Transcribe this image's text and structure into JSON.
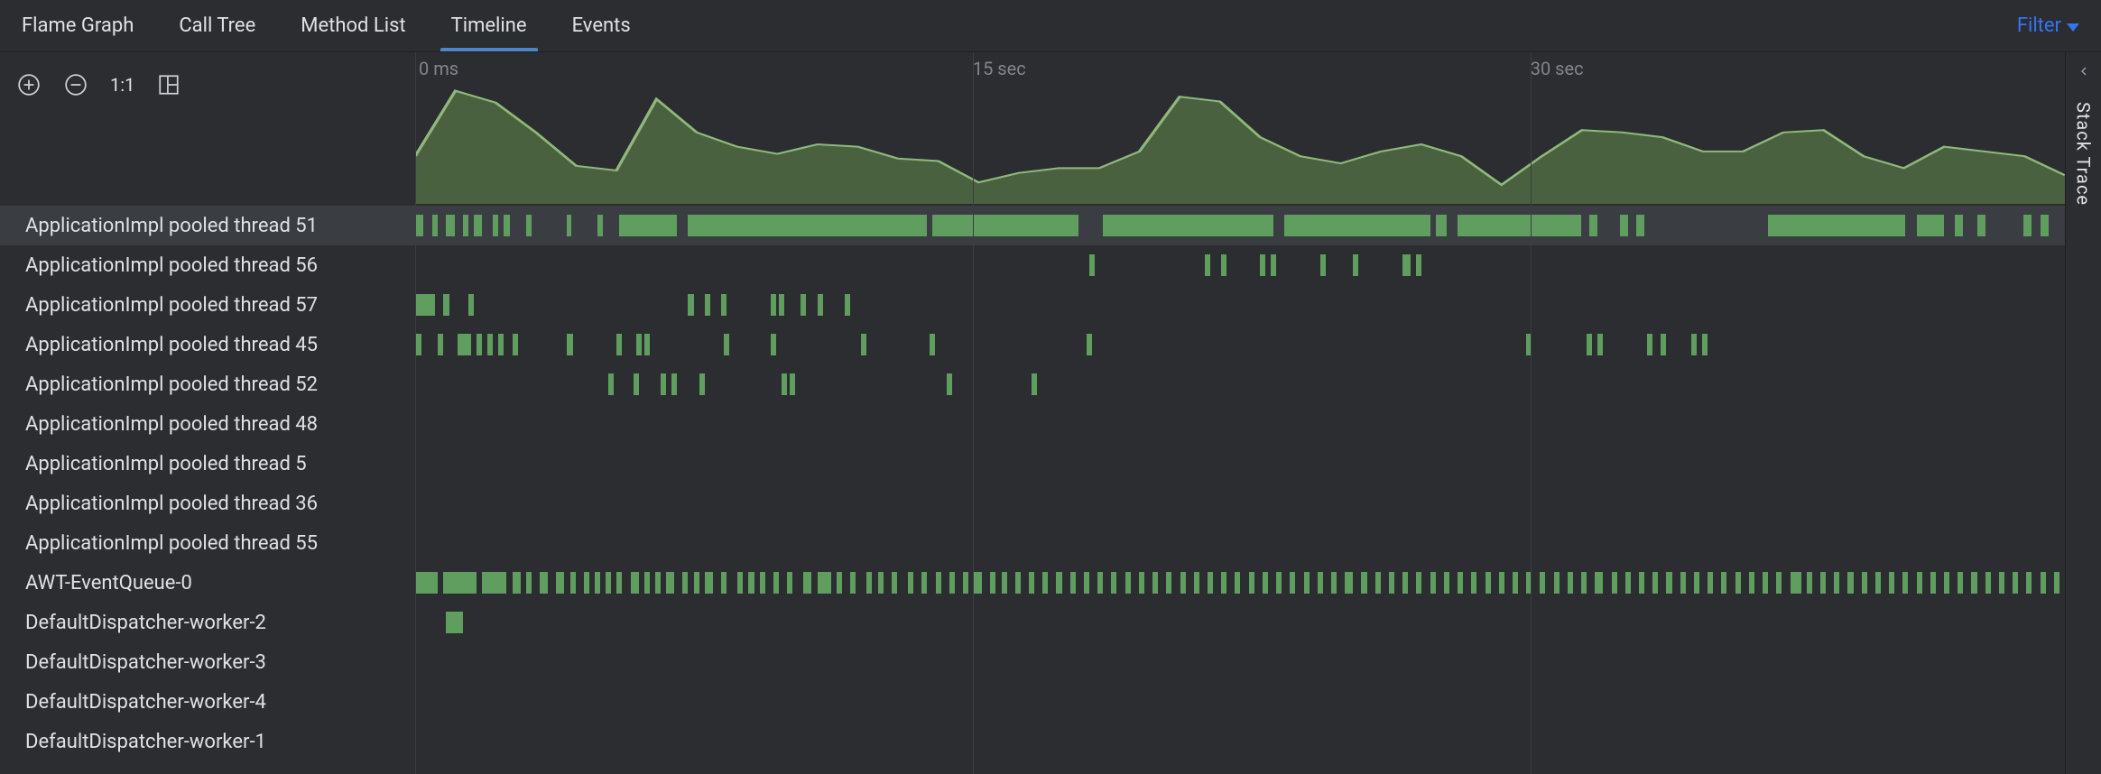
{
  "tabs": {
    "flame": "Flame Graph",
    "calltree": "Call Tree",
    "methodlist": "Method List",
    "timeline": "Timeline",
    "events": "Events"
  },
  "selected_tab": "timeline",
  "filter_label": "Filter",
  "toolbox": {
    "oneone": "1:1"
  },
  "ruler": {
    "t0": "0 ms",
    "t1": "15 sec",
    "t2": "30 sec"
  },
  "colors": {
    "area_fill": "#4f6b42",
    "area_stroke": "#8fb87a",
    "seg": "#5f9e5f",
    "accent": "#3574f0"
  },
  "side_panel_label": "Stack Trace",
  "chart_data": {
    "type": "area",
    "title": "",
    "xlabel": "time",
    "ylabel": "",
    "ylim": [
      0,
      100
    ],
    "x_range": [
      0,
      45
    ],
    "values": [
      40,
      95,
      85,
      60,
      32,
      28,
      88,
      60,
      48,
      42,
      50,
      48,
      38,
      36,
      18,
      26,
      30,
      30,
      44,
      90,
      86,
      56,
      40,
      34,
      44,
      50,
      40,
      16,
      40,
      62,
      60,
      56,
      44,
      44,
      60,
      62,
      40,
      30,
      48,
      44,
      40,
      24
    ]
  },
  "threads": [
    {
      "name": "ApplicationImpl pooled thread 51",
      "selected": true,
      "segs": [
        [
          0,
          0.5
        ],
        [
          1.2,
          0.4
        ],
        [
          2.2,
          0.6
        ],
        [
          3.4,
          0.4
        ],
        [
          4.2,
          0.6
        ],
        [
          5.6,
          0.4
        ],
        [
          6.4,
          0.4
        ],
        [
          8.0,
          0.4
        ],
        [
          11.0,
          0.3
        ],
        [
          13.2,
          0.4
        ],
        [
          14.8,
          4.2
        ],
        [
          19.8,
          17.4
        ],
        [
          37.6,
          10.6
        ],
        [
          50.0,
          12.4
        ],
        [
          63.2,
          10.6
        ],
        [
          74.2,
          0.8
        ],
        [
          75.8,
          9.0
        ],
        [
          85.4,
          0.6
        ],
        [
          87.6,
          0.6
        ],
        [
          88.8,
          0.6
        ],
        [
          98.4,
          10.0
        ],
        [
          109.2,
          2.0
        ],
        [
          112.0,
          0.6
        ],
        [
          113.6,
          0.6
        ],
        [
          117.0,
          0.6
        ],
        [
          118.2,
          0.6
        ]
      ]
    },
    {
      "name": "ApplicationImpl pooled thread 56",
      "selected": false,
      "segs": [
        [
          49.0,
          0.4
        ],
        [
          57.4,
          0.4
        ],
        [
          58.6,
          0.4
        ],
        [
          61.4,
          0.4
        ],
        [
          62.2,
          0.4
        ],
        [
          65.8,
          0.4
        ],
        [
          68.2,
          0.4
        ],
        [
          71.8,
          0.6
        ],
        [
          72.8,
          0.4
        ]
      ]
    },
    {
      "name": "ApplicationImpl pooled thread 57",
      "selected": false,
      "segs": [
        [
          0,
          1.4
        ],
        [
          2.0,
          0.4
        ],
        [
          3.8,
          0.4
        ],
        [
          19.8,
          0.4
        ],
        [
          21.0,
          0.4
        ],
        [
          22.2,
          0.4
        ],
        [
          25.8,
          0.4
        ],
        [
          26.4,
          0.4
        ],
        [
          28.0,
          0.4
        ],
        [
          29.2,
          0.4
        ],
        [
          31.2,
          0.4
        ]
      ]
    },
    {
      "name": "ApplicationImpl pooled thread 45",
      "selected": false,
      "segs": [
        [
          0,
          0.4
        ],
        [
          1.6,
          0.4
        ],
        [
          3.0,
          1.0
        ],
        [
          4.4,
          0.4
        ],
        [
          5.2,
          0.4
        ],
        [
          6.0,
          0.4
        ],
        [
          7.0,
          0.4
        ],
        [
          11.0,
          0.4
        ],
        [
          14.6,
          0.4
        ],
        [
          16.0,
          0.4
        ],
        [
          16.6,
          0.4
        ],
        [
          22.4,
          0.4
        ],
        [
          25.8,
          0.4
        ],
        [
          32.4,
          0.4
        ],
        [
          37.4,
          0.4
        ],
        [
          48.8,
          0.4
        ],
        [
          80.8,
          0.4
        ],
        [
          85.2,
          0.4
        ],
        [
          86.0,
          0.4
        ],
        [
          89.6,
          0.4
        ],
        [
          90.6,
          0.4
        ],
        [
          92.8,
          0.4
        ],
        [
          93.6,
          0.4
        ]
      ]
    },
    {
      "name": "ApplicationImpl pooled thread 52",
      "selected": false,
      "segs": [
        [
          14.0,
          0.4
        ],
        [
          15.8,
          0.4
        ],
        [
          17.8,
          0.4
        ],
        [
          18.6,
          0.4
        ],
        [
          20.6,
          0.4
        ],
        [
          26.6,
          0.4
        ],
        [
          27.2,
          0.4
        ],
        [
          38.6,
          0.4
        ],
        [
          44.8,
          0.4
        ]
      ]
    },
    {
      "name": "ApplicationImpl pooled thread 48",
      "selected": false,
      "segs": []
    },
    {
      "name": "ApplicationImpl pooled thread 5",
      "selected": false,
      "segs": []
    },
    {
      "name": "ApplicationImpl pooled thread 36",
      "selected": false,
      "segs": []
    },
    {
      "name": "ApplicationImpl pooled thread 55",
      "selected": false,
      "segs": []
    },
    {
      "name": "AWT-EventQueue-0",
      "selected": false,
      "segs": [
        [
          0,
          1.6
        ],
        [
          2.0,
          2.4
        ],
        [
          4.8,
          1.8
        ],
        [
          7.0,
          0.6
        ],
        [
          8.0,
          0.4
        ],
        [
          9.0,
          0.6
        ],
        [
          10.2,
          0.6
        ],
        [
          11.2,
          0.4
        ],
        [
          12.2,
          0.4
        ],
        [
          13.0,
          0.4
        ],
        [
          13.8,
          0.4
        ],
        [
          14.6,
          0.4
        ],
        [
          15.6,
          0.6
        ],
        [
          16.6,
          0.4
        ],
        [
          17.4,
          0.4
        ],
        [
          18.2,
          0.6
        ],
        [
          19.4,
          0.4
        ],
        [
          20.2,
          0.4
        ],
        [
          21.0,
          0.6
        ],
        [
          22.2,
          0.4
        ],
        [
          23.4,
          0.4
        ],
        [
          24.2,
          0.4
        ],
        [
          25.0,
          0.4
        ],
        [
          26.0,
          0.4
        ],
        [
          27.0,
          0.4
        ],
        [
          28.2,
          0.6
        ],
        [
          29.2,
          1.0
        ],
        [
          30.6,
          0.4
        ],
        [
          31.6,
          0.4
        ],
        [
          32.8,
          0.4
        ],
        [
          33.6,
          0.4
        ],
        [
          34.6,
          0.4
        ],
        [
          35.8,
          0.4
        ],
        [
          36.8,
          0.4
        ],
        [
          37.8,
          0.4
        ],
        [
          38.8,
          0.4
        ],
        [
          39.8,
          0.4
        ],
        [
          40.6,
          0.6
        ],
        [
          41.8,
          0.4
        ],
        [
          42.6,
          0.4
        ],
        [
          43.6,
          0.4
        ],
        [
          44.6,
          0.4
        ],
        [
          45.6,
          0.4
        ],
        [
          46.6,
          0.4
        ],
        [
          47.6,
          0.4
        ],
        [
          48.6,
          0.4
        ],
        [
          49.6,
          0.4
        ],
        [
          50.6,
          0.4
        ],
        [
          51.6,
          0.4
        ],
        [
          52.6,
          0.4
        ],
        [
          53.6,
          0.4
        ],
        [
          54.6,
          0.4
        ],
        [
          55.6,
          0.4
        ],
        [
          56.6,
          0.4
        ],
        [
          57.6,
          0.4
        ],
        [
          58.6,
          0.4
        ],
        [
          59.6,
          0.4
        ],
        [
          60.6,
          0.4
        ],
        [
          61.6,
          0.4
        ],
        [
          62.6,
          0.4
        ],
        [
          63.6,
          0.4
        ],
        [
          64.6,
          0.4
        ],
        [
          65.6,
          0.4
        ],
        [
          66.6,
          0.4
        ],
        [
          67.6,
          0.6
        ],
        [
          68.8,
          0.4
        ],
        [
          69.8,
          0.4
        ],
        [
          70.8,
          0.4
        ],
        [
          71.8,
          0.4
        ],
        [
          72.8,
          0.4
        ],
        [
          73.8,
          0.4
        ],
        [
          74.8,
          0.4
        ],
        [
          75.8,
          0.4
        ],
        [
          76.8,
          0.4
        ],
        [
          77.8,
          0.4
        ],
        [
          78.8,
          0.4
        ],
        [
          79.8,
          0.4
        ],
        [
          80.8,
          0.4
        ],
        [
          81.8,
          0.4
        ],
        [
          82.8,
          0.4
        ],
        [
          83.8,
          0.4
        ],
        [
          84.8,
          0.4
        ],
        [
          85.8,
          0.6
        ],
        [
          87.0,
          0.4
        ],
        [
          88.0,
          0.4
        ],
        [
          89.0,
          0.4
        ],
        [
          90.0,
          0.4
        ],
        [
          91.0,
          0.4
        ],
        [
          92.0,
          0.4
        ],
        [
          93.0,
          0.4
        ],
        [
          94.0,
          0.4
        ],
        [
          95.0,
          0.4
        ],
        [
          96.0,
          0.4
        ],
        [
          97.0,
          0.4
        ],
        [
          98.0,
          0.4
        ],
        [
          99.0,
          0.4
        ],
        [
          100.0,
          0.8
        ],
        [
          101.2,
          0.4
        ],
        [
          102.2,
          0.4
        ],
        [
          103.2,
          0.4
        ],
        [
          104.2,
          0.4
        ],
        [
          105.2,
          0.4
        ],
        [
          106.2,
          0.4
        ],
        [
          107.2,
          0.4
        ],
        [
          108.2,
          0.4
        ],
        [
          109.2,
          0.4
        ],
        [
          110.2,
          0.4
        ],
        [
          111.2,
          0.4
        ],
        [
          112.2,
          0.4
        ],
        [
          113.2,
          0.4
        ],
        [
          114.2,
          0.4
        ],
        [
          115.2,
          0.4
        ],
        [
          116.2,
          0.4
        ],
        [
          117.2,
          0.4
        ],
        [
          118.2,
          0.4
        ],
        [
          119.2,
          0.4
        ]
      ]
    },
    {
      "name": "DefaultDispatcher-worker-2",
      "selected": false,
      "segs": [
        [
          2.2,
          1.2
        ]
      ]
    },
    {
      "name": "DefaultDispatcher-worker-3",
      "selected": false,
      "segs": []
    },
    {
      "name": "DefaultDispatcher-worker-4",
      "selected": false,
      "segs": []
    },
    {
      "name": "DefaultDispatcher-worker-1",
      "selected": false,
      "segs": []
    }
  ]
}
